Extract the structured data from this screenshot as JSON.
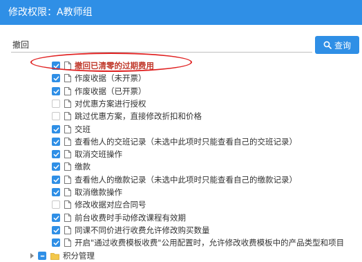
{
  "window": {
    "title": "修改权限：A教师组"
  },
  "search": {
    "value": "撤回",
    "button_label": "查询"
  },
  "tree": {
    "items": [
      {
        "label": "撤回已清零的过期费用",
        "checked": "on",
        "highlight": true
      },
      {
        "label": "作废收据（未开票）",
        "checked": "on"
      },
      {
        "label": "作废收据（已开票）",
        "checked": "on"
      },
      {
        "label": "对优惠方案进行授权",
        "checked": "off"
      },
      {
        "label": "跳过优惠方案，直接修改折扣和价格",
        "checked": "off"
      },
      {
        "label": "交班",
        "checked": "on"
      },
      {
        "label": "查看他人的交班记录（未选中此项时只能查看自己的交班记录）",
        "checked": "on"
      },
      {
        "label": "取消交班操作",
        "checked": "on"
      },
      {
        "label": "缴款",
        "checked": "on"
      },
      {
        "label": "查看他人的缴款记录（未选中此项时只能查看自己的缴款记录）",
        "checked": "on"
      },
      {
        "label": "取消缴款操作",
        "checked": "on"
      },
      {
        "label": "修改收据对应合同号",
        "checked": "off"
      },
      {
        "label": "前台收费时手动修改课程有效期",
        "checked": "on"
      },
      {
        "label": "同课不同价进行收费允许修改购买数量",
        "checked": "on"
      },
      {
        "label": "开启\"通过收费模板收费\"公用配置时，允许修改收费模板中的产品类型和项目",
        "checked": "on"
      }
    ],
    "parent": {
      "label": "积分管理",
      "checked": "part"
    }
  },
  "colors": {
    "accent": "#2f8fe6",
    "highlight": "#c0392b",
    "annotation": "#e02020"
  }
}
